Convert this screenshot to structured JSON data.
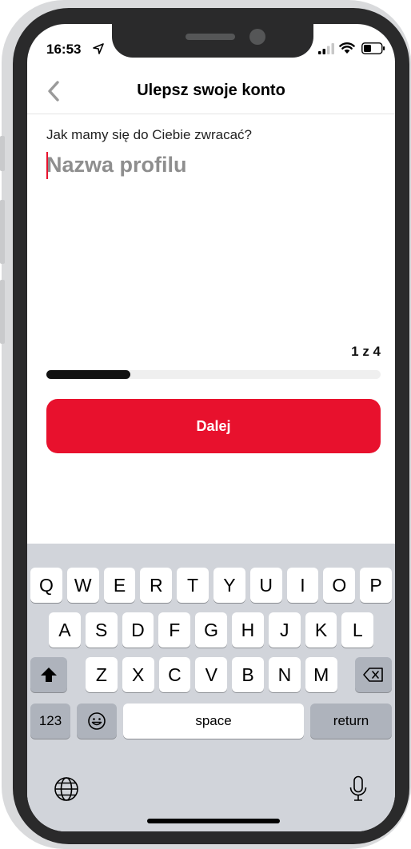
{
  "status_bar": {
    "time": "16:53"
  },
  "nav": {
    "title": "Ulepsz swoje konto"
  },
  "form": {
    "question": "Jak mamy się do Ciebie zwracać?",
    "name_placeholder": "Nazwa profilu",
    "name_value": ""
  },
  "progress": {
    "step_label": "1 z 4",
    "current_step": 1,
    "total_steps": 4,
    "fraction": 0.25
  },
  "actions": {
    "next_label": "Dalej"
  },
  "keyboard": {
    "row1": [
      "Q",
      "W",
      "E",
      "R",
      "T",
      "Y",
      "U",
      "I",
      "O",
      "P"
    ],
    "row2": [
      "A",
      "S",
      "D",
      "F",
      "G",
      "H",
      "J",
      "K",
      "L"
    ],
    "row3": [
      "Z",
      "X",
      "C",
      "V",
      "B",
      "N",
      "M"
    ],
    "numbers_label": "123",
    "space_label": "space",
    "return_label": "return"
  },
  "colors": {
    "accent": "#e8112d",
    "progress_fill": "#111111",
    "keyboard_bg": "#d1d4da"
  }
}
